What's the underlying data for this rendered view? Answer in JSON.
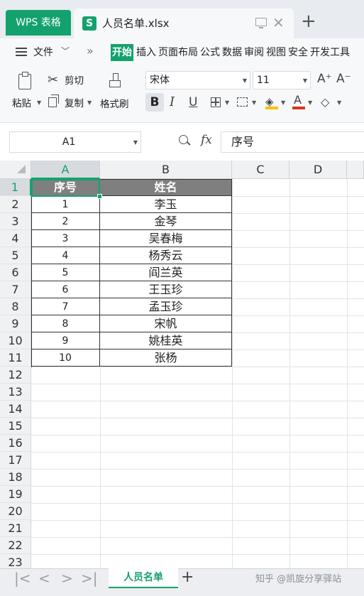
{
  "window": {
    "app_tab_label": "WPS 表格",
    "doc_icon_letter": "S",
    "doc_tab_title": "人员名单.xlsx",
    "new_tab_symbol": "+",
    "close_tab_symbol": "✕"
  },
  "menu": {
    "file_label": "文件",
    "tabs": [
      "开始",
      "插入",
      "页面布局",
      "公式",
      "数据",
      "审阅",
      "视图",
      "安全",
      "开发工具"
    ],
    "active_tab": "开始"
  },
  "ribbon": {
    "paste_label": "粘贴",
    "cut_label": "剪切",
    "copy_label": "复制",
    "format_painter_label": "格式刷",
    "font_name": "宋体",
    "font_size": "11",
    "bold_label": "B",
    "italic_label": "I",
    "underline_label": "U",
    "grow_font_label": "A⁺",
    "shrink_font_label": "A⁻",
    "font_color_label": "A",
    "fill_color": "#f5c400",
    "font_color": "#e0321e"
  },
  "formula_bar": {
    "name_box": "A1",
    "fx_label": "fx",
    "formula": "序号"
  },
  "sheet": {
    "columns": [
      "A",
      "B",
      "C",
      "D"
    ],
    "selected_column": "A",
    "row_numbers": [
      "1",
      "2",
      "3",
      "4",
      "5",
      "6",
      "7",
      "8",
      "9",
      "10",
      "11",
      "12",
      "13",
      "14",
      "15",
      "16",
      "17",
      "18",
      "19",
      "20",
      "21",
      "22",
      "23"
    ],
    "header": [
      "序号",
      "姓名"
    ],
    "rows": [
      [
        "1",
        "李玉"
      ],
      [
        "2",
        "金琴"
      ],
      [
        "3",
        "吴春梅"
      ],
      [
        "4",
        "杨秀云"
      ],
      [
        "5",
        "阎兰英"
      ],
      [
        "6",
        "王玉珍"
      ],
      [
        "7",
        "孟玉珍"
      ],
      [
        "8",
        "宋帆"
      ],
      [
        "9",
        "姚桂英"
      ],
      [
        "10",
        "张杨"
      ]
    ],
    "header_fill": "#7f7f7f",
    "accent": "#13a26e"
  },
  "sheet_tabs": {
    "active": "人员名单",
    "add_symbol": "+",
    "nav": [
      "|<",
      "<",
      ">",
      ">|"
    ]
  },
  "watermark": "知乎 @凯旋分享驿站",
  "icons": [
    "hamburger-icon",
    "paste-icon",
    "cut-icon",
    "copy-icon",
    "format-painter-icon",
    "border-icon",
    "cell-style-icon",
    "fill-color-icon",
    "font-color-icon",
    "eraser-icon",
    "zoom-icon",
    "fx-icon",
    "monitor-icon"
  ]
}
